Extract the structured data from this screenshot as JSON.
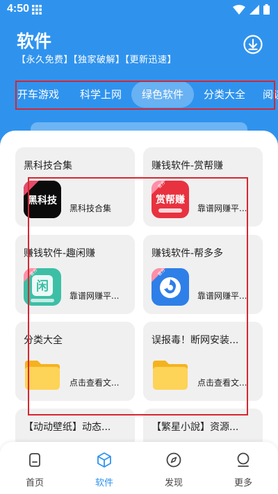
{
  "status": {
    "time": "4:50"
  },
  "header": {
    "title": "软件",
    "subtitle": "【永久免费】【独家破解】【更新迅速】"
  },
  "tabs": [
    {
      "label": "开车游戏"
    },
    {
      "label": "科学上网"
    },
    {
      "label": "绿色软件",
      "active": true
    },
    {
      "label": "分类大全"
    },
    {
      "label": "阅读"
    }
  ],
  "cards": [
    {
      "title": "黑科技合集",
      "desc": "黑科技合集",
      "icon": "black-tech-app-icon",
      "icon_text": "黑科技",
      "badge": ""
    },
    {
      "title": "赚钱软件-赏帮赚",
      "desc": "靠谱网赚平...",
      "icon": "shangbangzhuan-app-icon",
      "icon_text": "赏帮赚",
      "badge": "官方"
    },
    {
      "title": "赚钱软件-趣闲赚",
      "desc": "靠谱网赚平...",
      "icon": "quxianzhuan-app-icon",
      "icon_text": "闲",
      "badge": "官方"
    },
    {
      "title": "赚钱软件-帮多多",
      "desc": "靠谱网赚平...",
      "icon": "bangduoduo-app-icon",
      "icon_text": "",
      "badge": "官方"
    },
    {
      "title": "分类大全",
      "desc": "点击查看文...",
      "icon": "folder-icon",
      "icon_text": "",
      "badge": ""
    },
    {
      "title": "误报毒！断网安装...",
      "desc": "点击查看文...",
      "icon": "folder-icon",
      "icon_text": "",
      "badge": ""
    },
    {
      "title": "【动动壁纸】动态...",
      "desc": "",
      "icon": "",
      "icon_text": "",
      "badge": ""
    },
    {
      "title": "【繁星小說】资源...",
      "desc": "",
      "icon": "",
      "icon_text": "",
      "badge": ""
    }
  ],
  "nav": [
    {
      "label": "首页",
      "icon": "home-icon"
    },
    {
      "label": "软件",
      "icon": "software-icon",
      "active": true
    },
    {
      "label": "发现",
      "icon": "compass-icon"
    },
    {
      "label": "更多",
      "icon": "more-icon"
    }
  ],
  "colors": {
    "primary": "#2f93ee",
    "highlight_box": "#d8262f"
  }
}
